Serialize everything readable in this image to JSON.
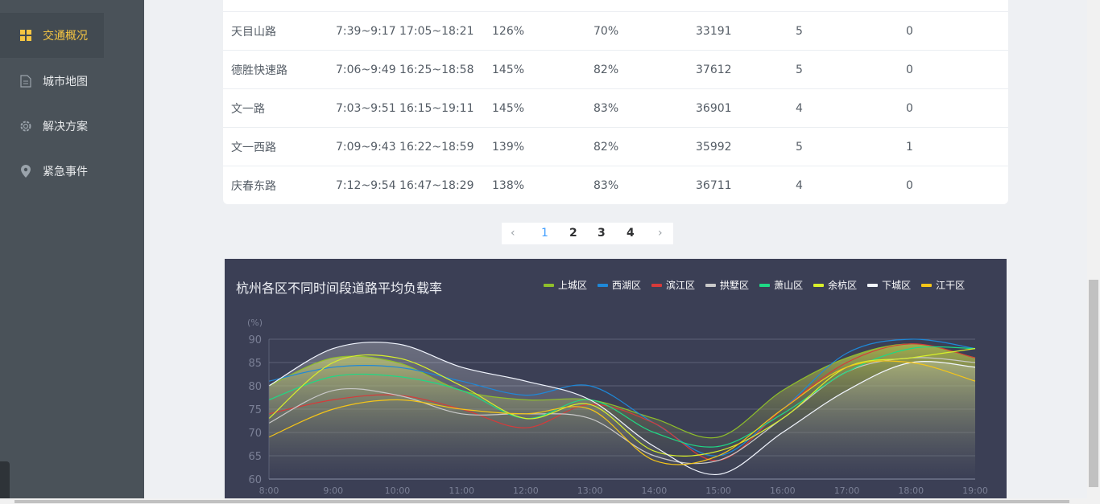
{
  "sidebar": {
    "items": [
      {
        "label": "交通概况",
        "icon": "grid-icon",
        "active": true
      },
      {
        "label": "城市地图",
        "icon": "document-icon",
        "active": false
      },
      {
        "label": "解决方案",
        "icon": "gear-icon",
        "active": false
      },
      {
        "label": "紧急事件",
        "icon": "location-pin-icon",
        "active": false
      }
    ]
  },
  "table": {
    "rows": [
      {
        "name": "天目山路",
        "peak": "7:39~9:17 17:05~18:21",
        "rate1": "126%",
        "rate2": "70%",
        "count": "33191",
        "level": "5",
        "events": "0"
      },
      {
        "name": "德胜快速路",
        "peak": "7:06~9:49 16:25~18:58",
        "rate1": "145%",
        "rate2": "82%",
        "count": "37612",
        "level": "5",
        "events": "0"
      },
      {
        "name": "文一路",
        "peak": "7:03~9:51 16:15~19:11",
        "rate1": "145%",
        "rate2": "83%",
        "count": "36901",
        "level": "4",
        "events": "0"
      },
      {
        "name": "文一西路",
        "peak": "7:09~9:43 16:22~18:59",
        "rate1": "139%",
        "rate2": "82%",
        "count": "35992",
        "level": "5",
        "events": "1"
      },
      {
        "name": "庆春东路",
        "peak": "7:12~9:54 16:47~18:29",
        "rate1": "138%",
        "rate2": "83%",
        "count": "36711",
        "level": "4",
        "events": "0"
      }
    ]
  },
  "pagination": {
    "prev": "‹",
    "next": "›",
    "pages": [
      "1",
      "2",
      "3",
      "4"
    ],
    "current": "1"
  },
  "chart_data": {
    "type": "line",
    "title": "杭州各区不同时间段道路平均负载率",
    "ylabel": "(%)",
    "ylim": [
      60,
      90
    ],
    "yticks": [
      "90",
      "85",
      "80",
      "75",
      "70",
      "65",
      "60"
    ],
    "x": [
      "8:00",
      "9:00",
      "10:00",
      "11:00",
      "12:00",
      "13:00",
      "14:00",
      "15:00",
      "16:00",
      "17:00",
      "18:00",
      "19:00"
    ],
    "legend_position": "top-right",
    "series": [
      {
        "name": "上城区",
        "color": "#8fbf2a",
        "values": [
          80,
          86,
          85,
          79,
          77,
          77,
          73,
          69,
          79,
          86,
          89,
          86
        ]
      },
      {
        "name": "西湖区",
        "color": "#1e88d8",
        "values": [
          81,
          84,
          84,
          81,
          78,
          80,
          72,
          65,
          75,
          87,
          90,
          88
        ]
      },
      {
        "name": "滨江区",
        "color": "#d63a3a",
        "values": [
          74,
          77,
          78,
          75,
          71,
          76,
          72,
          64,
          75,
          85,
          89,
          86
        ]
      },
      {
        "name": "拱墅区",
        "color": "#c9c9c9",
        "values": [
          72,
          79,
          78,
          74,
          74,
          73,
          65,
          64,
          73,
          83,
          86,
          85
        ]
      },
      {
        "name": "萧山区",
        "color": "#1ed985",
        "values": [
          77,
          82,
          82,
          79,
          73,
          77,
          70,
          67,
          74,
          83,
          88,
          88
        ]
      },
      {
        "name": "余杭区",
        "color": "#d8f02a",
        "values": [
          73,
          85,
          86,
          80,
          73,
          76,
          66,
          66,
          73,
          84,
          86,
          88
        ]
      },
      {
        "name": "下城区",
        "color": "#f2f6ff",
        "values": [
          80,
          88,
          89,
          84,
          81,
          77,
          67,
          61,
          70,
          79,
          85,
          84
        ]
      },
      {
        "name": "江干区",
        "color": "#f5c518",
        "values": [
          69,
          75,
          77,
          75,
          74,
          75,
          64,
          65,
          75,
          84,
          85,
          81
        ]
      }
    ]
  }
}
